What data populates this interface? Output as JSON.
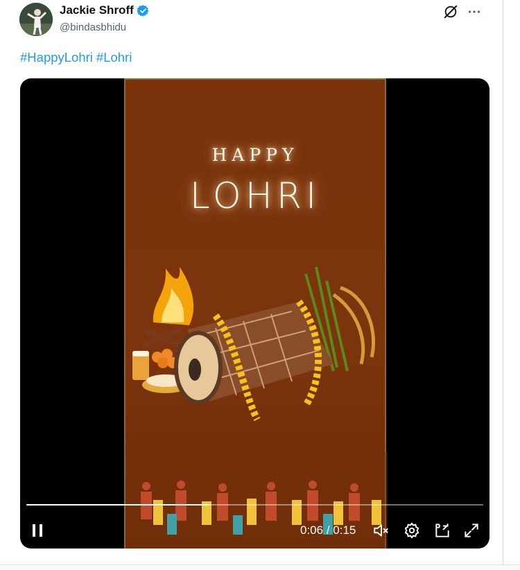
{
  "author": {
    "display_name": "Jackie Shroff",
    "handle": "@bindasbhidu",
    "verified": true
  },
  "hashtags": [
    "#HappyLohri",
    "#Lohri"
  ],
  "video": {
    "title_line1": "HAPPY",
    "title_line2": "LOHRI",
    "current_time": "0:06",
    "separator": "/",
    "duration": "0:15",
    "progress": 0.4
  },
  "icons": {
    "grok": "grok-icon",
    "more": "more-icon",
    "pause": "pause-icon",
    "mute": "muted-speaker-icon",
    "settings": "settings-gear-icon",
    "pip": "picture-in-picture-icon",
    "fullscreen": "fullscreen-icon"
  },
  "colors": {
    "accent": "#1d9bf0",
    "frame_bg": "#7a340d"
  }
}
